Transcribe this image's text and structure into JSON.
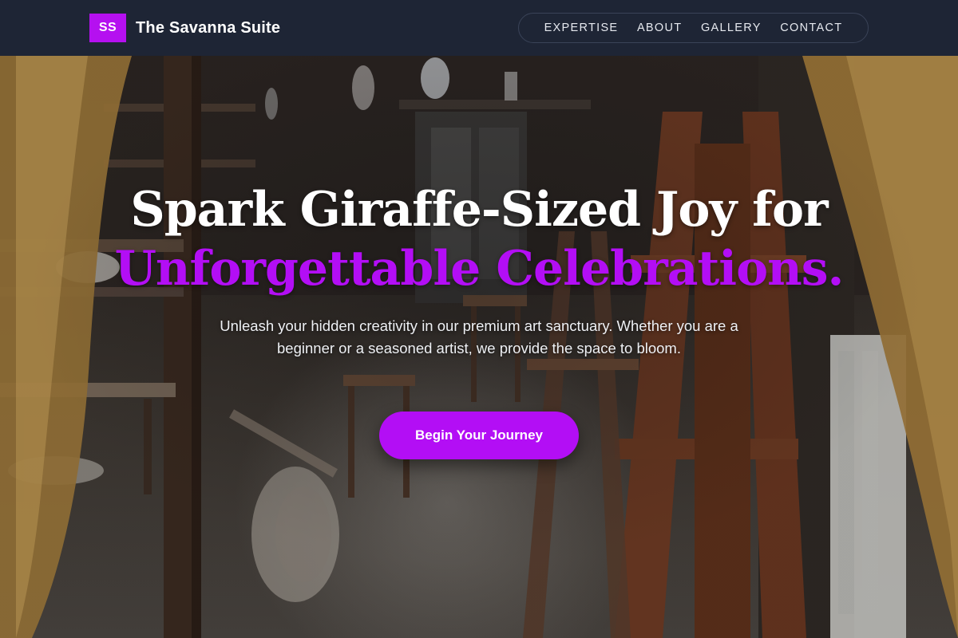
{
  "brand": {
    "badge": "SS",
    "name": "The Savanna Suite"
  },
  "nav": {
    "items": [
      "EXPERTISE",
      "ABOUT",
      "GALLERY",
      "CONTACT"
    ]
  },
  "hero": {
    "headline_line1": "Spark Giraffe-Sized Joy for",
    "headline_line2": "Unforgettable Celebrations.",
    "subtext": "Unleash your hidden creativity in our premium art sanctuary. Whether you are a beginner or a seasoned artist, we provide the space to bloom.",
    "cta_label": "Begin Your Journey"
  },
  "colors": {
    "header_bg": "#1e2535",
    "accent": "#b30ef5",
    "headline_white": "#ffffff",
    "text_light": "#eef0f4"
  }
}
